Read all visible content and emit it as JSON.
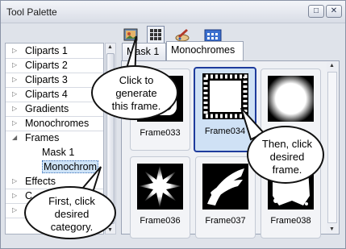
{
  "window": {
    "title": "Tool Palette",
    "pin_icon": "pin-icon",
    "close_icon": "close-icon"
  },
  "toolbar": {
    "icons": [
      "generate-frame-icon",
      "grid-view-icon",
      "paint-icon",
      "palette-icon"
    ]
  },
  "tree": {
    "items": [
      {
        "label": "Cliparts 1",
        "expanded": false
      },
      {
        "label": "Cliparts 2",
        "expanded": false
      },
      {
        "label": "Cliparts 3",
        "expanded": false
      },
      {
        "label": "Cliparts 4",
        "expanded": false
      },
      {
        "label": "Gradients",
        "expanded": false
      },
      {
        "label": "Monochromes",
        "expanded": false
      },
      {
        "label": "Frames",
        "expanded": true
      },
      {
        "label": "Mask 1",
        "child": true
      },
      {
        "label": "Monochrom",
        "child": true,
        "selected": true
      },
      {
        "label": "Effects",
        "expanded": false
      },
      {
        "label": "C",
        "expanded": false
      },
      {
        "label": "",
        "expanded": false
      }
    ]
  },
  "tabs": [
    {
      "label": "Mask 1",
      "active": false
    },
    {
      "label": "Monochromes",
      "active": true
    }
  ],
  "grid": {
    "items": [
      {
        "label": "Frame033",
        "selected": false
      },
      {
        "label": "Frame034",
        "selected": true
      },
      {
        "label": "",
        "selected": false
      },
      {
        "label": "Frame036",
        "selected": false
      },
      {
        "label": "Frame037",
        "selected": false
      },
      {
        "label": "Frame038",
        "selected": false
      }
    ]
  },
  "callouts": {
    "generate": "Click  to generate this frame.",
    "then": "Then, click desired frame.",
    "first": "First, click desired category."
  },
  "colors": {
    "selection_border": "#1e3b9c",
    "selection_fill": "#cfe1f5"
  }
}
